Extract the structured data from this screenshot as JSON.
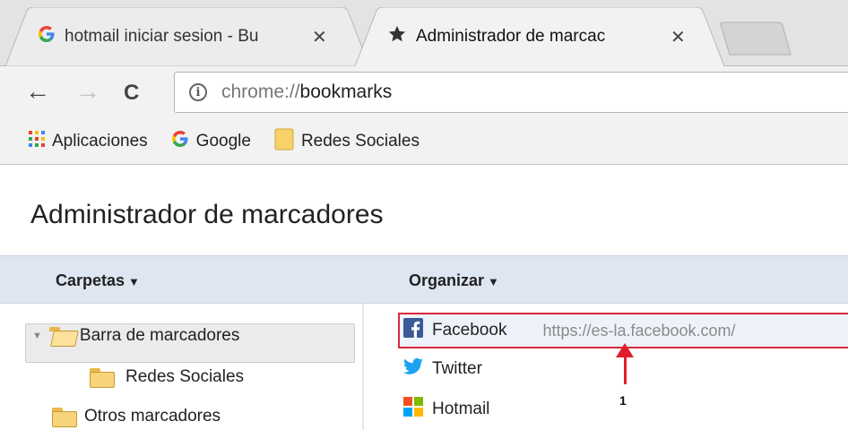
{
  "tabs": [
    {
      "title": "hotmail iniciar sesion - Bu",
      "icon": "google-icon",
      "close": "✕"
    },
    {
      "title": "Administrador de marcac",
      "icon": "star-icon",
      "close": "✕"
    }
  ],
  "toolbar": {
    "back": "←",
    "forward": "→",
    "reload": "C",
    "info_icon": "i",
    "url_scheme": "chrome://",
    "url_host": "bookmarks"
  },
  "bookmarks_bar": [
    {
      "label": "Aplicaciones",
      "icon": "apps-grid-icon"
    },
    {
      "label": "Google",
      "icon": "google-icon"
    },
    {
      "label": "Redes Sociales",
      "icon": "folder-icon"
    }
  ],
  "page": {
    "title": "Administrador de marcadores",
    "folders_menu": "Carpetas",
    "organize_menu": "Organizar",
    "caret": "▼",
    "tree": [
      {
        "label": "Barra de marcadores",
        "expander": "▼"
      },
      {
        "label": "Redes Sociales"
      },
      {
        "label": "Otros marcadores"
      }
    ],
    "bookmarks": [
      {
        "label": "Facebook",
        "url": "https://es-la.facebook.com/",
        "icon": "facebook-icon",
        "color": "#3b5998"
      },
      {
        "label": "Twitter",
        "icon": "twitter-icon",
        "color": "#1da1f2"
      },
      {
        "label": "Hotmail",
        "icon": "windows-icon"
      }
    ],
    "annotation_number": "1"
  },
  "colors": {
    "highlight_border": "#d9293b",
    "header_band": "#dee6f2",
    "annotation_arrow": "#e01e2a"
  }
}
